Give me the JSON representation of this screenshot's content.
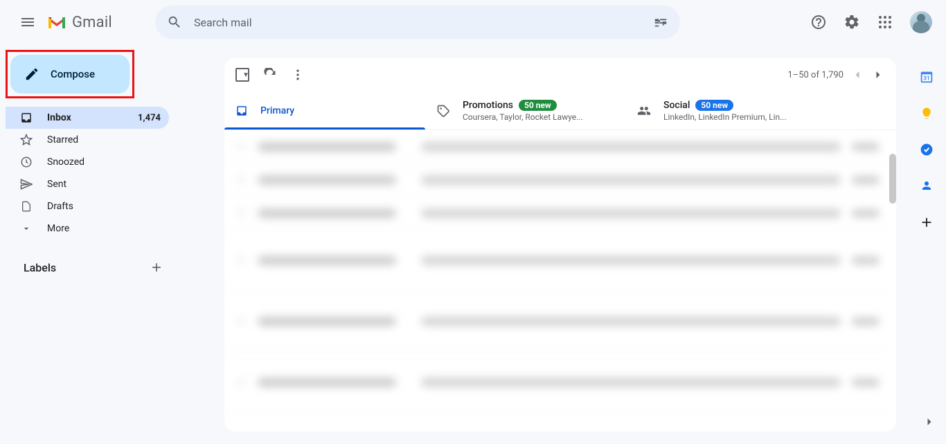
{
  "header": {
    "app_name": "Gmail",
    "search_placeholder": "Search mail"
  },
  "compose": {
    "label": "Compose"
  },
  "sidebar": {
    "items": [
      {
        "label": "Inbox",
        "count": "1,474",
        "icon": "inbox",
        "active": true
      },
      {
        "label": "Starred",
        "icon": "star"
      },
      {
        "label": "Snoozed",
        "icon": "clock"
      },
      {
        "label": "Sent",
        "icon": "send"
      },
      {
        "label": "Drafts",
        "icon": "draft"
      },
      {
        "label": "More",
        "icon": "more"
      }
    ],
    "labels_header": "Labels"
  },
  "toolbar": {
    "pagination": "1–50 of 1,790"
  },
  "tabs": [
    {
      "label": "Primary",
      "active": true
    },
    {
      "label": "Promotions",
      "badge": "50 new",
      "badge_style": "green",
      "sub": "Coursera, Taylor, Rocket Lawye..."
    },
    {
      "label": "Social",
      "badge": "50 new",
      "badge_style": "blue",
      "sub": "LinkedIn, LinkedIn Premium, Lin..."
    }
  ],
  "sidepanel": {
    "calendar_day": "31"
  }
}
